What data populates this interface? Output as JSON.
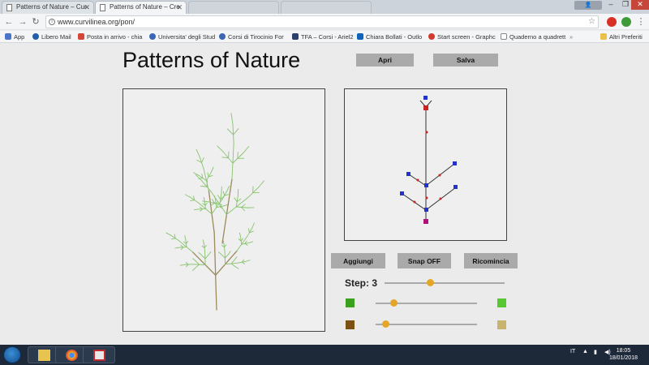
{
  "browser": {
    "tabs": [
      {
        "title": "Patterns of Nature – Cur",
        "active": false
      },
      {
        "title": "Patterns of Nature – Cre",
        "active": true
      },
      {
        "title": "",
        "active": false
      },
      {
        "title": "",
        "active": false
      }
    ],
    "address": "www.curvilinea.org/pon/",
    "bookmarks": [
      {
        "label": "App"
      },
      {
        "label": "Libero Mail"
      },
      {
        "label": "Posta in arrivo - chia"
      },
      {
        "label": "Universita' degli Stud"
      },
      {
        "label": "Corsi di Tirocinio For"
      },
      {
        "label": "TFA – Corsi - Ariel2"
      },
      {
        "label": "Chiara Bollati - Outlo"
      },
      {
        "label": "Start screen - Graphc"
      },
      {
        "label": "Quaderno a quadrett"
      },
      {
        "label": "Altri Preferiti"
      }
    ]
  },
  "app": {
    "title": "Patterns of Nature",
    "buttons": {
      "open": "Apri",
      "save": "Salva",
      "add": "Aggiungi",
      "snap": "Snap OFF",
      "restart": "Ricomincia"
    },
    "step_label": "Step: 3",
    "sliders": [
      {
        "name": "step",
        "value_fraction": 0.38
      },
      {
        "name": "color-1",
        "value_fraction": 0.18
      },
      {
        "name": "color-2",
        "value_fraction": 0.1
      }
    ],
    "colors": {
      "plant": "#88c46e",
      "stem": "#9a8a5c",
      "leaf_start": "#3aa01e",
      "leaf_end": "#58c832",
      "stem_start": "#7a5212",
      "stem_end": "#c8b46c",
      "knob": "#e5a628",
      "button": "#aaaaaa"
    }
  },
  "taskbar": {
    "language": "IT",
    "time": "18:05",
    "date": "18/01/2018"
  }
}
